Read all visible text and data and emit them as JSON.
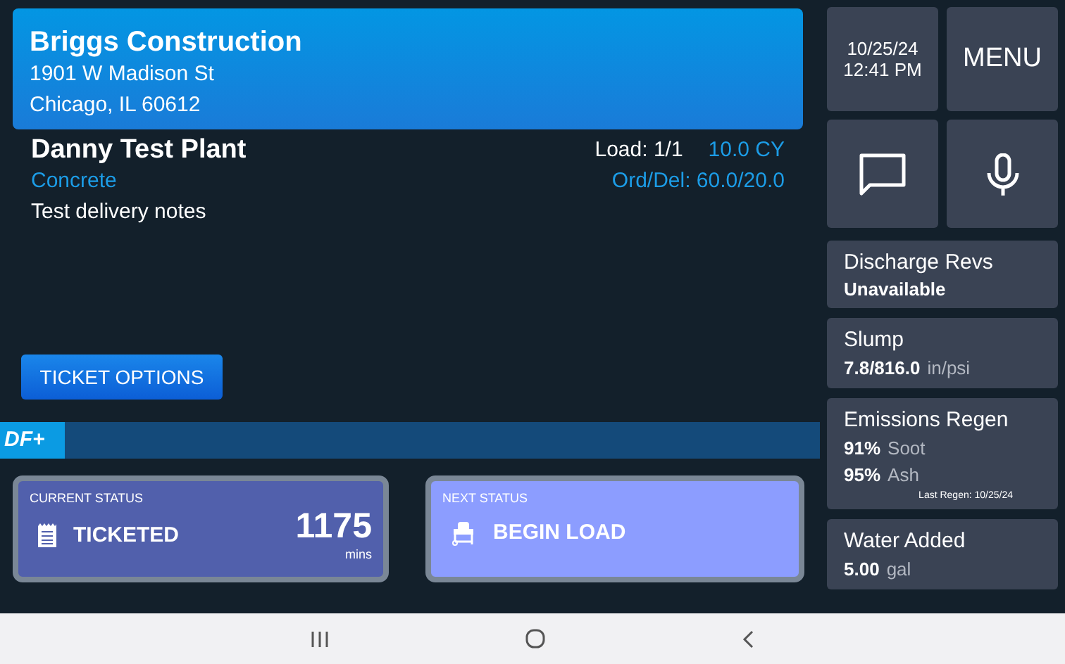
{
  "job": {
    "customer": "Briggs Construction",
    "address_lines": [
      "1901 W Madison St",
      "Chicago, IL 60612"
    ]
  },
  "plant": {
    "name": "Danny Test Plant",
    "product": "Concrete",
    "notes": "Test delivery notes",
    "load": "Load: 1/1",
    "volume": "10.0 CY",
    "ord_del": "Ord/Del: 60.0/20.0"
  },
  "ticket_options_button": "TICKET OPTIONS",
  "logo": "DF+",
  "statuses": [
    {
      "kind": "current",
      "label": "CURRENT STATUS",
      "value": "TICKETED",
      "time": "1175",
      "unit": "mins"
    },
    {
      "kind": "next",
      "label": "NEXT STATUS",
      "value": "BEGIN LOAD"
    }
  ],
  "clock": {
    "date": "10/25/24",
    "time": "12:41 PM"
  },
  "menu_button": "MENU",
  "sensors": [
    {
      "title": "Discharge Revs",
      "lines": [
        {
          "value": "Unavailable"
        }
      ]
    },
    {
      "title": "Slump",
      "lines": [
        {
          "value": "7.8/816.0",
          "unit": "in/psi"
        }
      ]
    },
    {
      "title": "Emissions Regen",
      "lines": [
        {
          "value": "91%",
          "unit": "Soot"
        },
        {
          "value": "95%",
          "unit": "Ash"
        }
      ],
      "footnote": "Last Regen: 10/25/24"
    },
    {
      "title": "Water Added",
      "lines": [
        {
          "value": "5.00",
          "unit": "gal"
        }
      ]
    }
  ]
}
